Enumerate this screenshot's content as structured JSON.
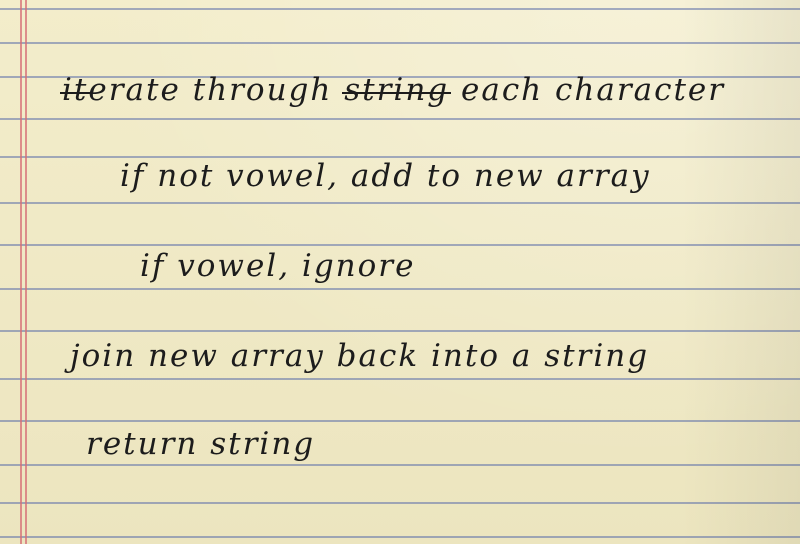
{
  "notes": {
    "line1": {
      "strike1": "it",
      "part1": "erate through ",
      "strike2": "string",
      "part2": " each character"
    },
    "line2": "if not vowel, add to new array",
    "line3": "if vowel, ignore",
    "line4": "join new array back into a string",
    "line5": "return string"
  },
  "paper": {
    "background_color": "#efe9c4",
    "rule_color": "#5c70aa",
    "margin_color": "#d66e76",
    "ink_color": "#1c1c1c"
  }
}
